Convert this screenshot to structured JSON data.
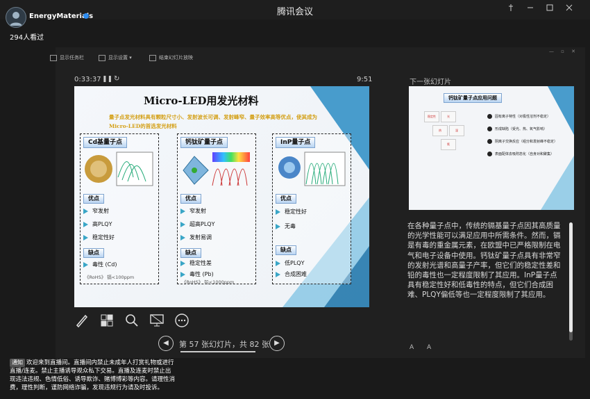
{
  "window": {
    "title": "腾讯会议"
  },
  "stream": {
    "streamer_name": "EnergyMaterials",
    "viewers": "294人看过"
  },
  "toolbar": {
    "show_taskbar": "显示任务栏",
    "display_settings": "显示设置 ▾",
    "end_slideshow": "结束幻灯片放映"
  },
  "presenter": {
    "elapsed": "0:33:37",
    "pause_icon": "pause-icon",
    "reset_icon": "reset-icon",
    "clock": "9:51",
    "next_slide_label": "下一张幻灯片",
    "slide_counter": "第 57 张幻灯片，共 82 张",
    "font_buttons": "A  A"
  },
  "slide": {
    "title": "Micro-LED用发光材料",
    "subtitle": "量子点发光材料具有颗粒尺寸小、发射波长可调、发射峰窄、量子效率高等优点，使其成为Micro-LED的首选发光材料",
    "boxes": [
      {
        "heading": "Cd基量子点",
        "pros_label": "优点",
        "pros": [
          "窄发射",
          "高PLQY",
          "稳定性好"
        ],
        "cons_label": "缺点",
        "cons": [
          "毒性 (Cd)"
        ],
        "footnote": "《RoHS》 镉<100ppm"
      },
      {
        "heading": "钙钛矿量子点",
        "pros_label": "优点",
        "pros": [
          "窄发射",
          "超高PLQY",
          "发射易调"
        ],
        "cons_label": "缺点",
        "cons": [
          "稳定性差",
          "毒性 (Pb)"
        ],
        "footnote": "《RoHS》 铅<1000ppm"
      },
      {
        "heading": "InP量子点",
        "pros_label": "优点",
        "pros": [
          "稳定性好",
          "无毒"
        ],
        "cons_label": "缺点",
        "cons": [
          "低PLQY",
          "合成困难"
        ],
        "footnote": ""
      }
    ]
  },
  "next_slide": {
    "title": "钙钛矿量子点应用问题",
    "items": [
      "固有离子特性（对极性溶剂不稳定）",
      "形成缺陷（受光、热、氧气影响）",
      "阴离子交换反应（组分和发射峰不稳定）",
      "表面配体去吸附态化（自身对和聚集）"
    ],
    "hexes": [
      "稳定性",
      "光",
      "热",
      "湿",
      "氧"
    ]
  },
  "notes": "在各种量子点中，传统的镉基量子点因其高质量的光学性能可以满足应用中所需条件。然而，镉是有毒的重金属元素，在欧盟中已严格限制在电气和电子设备中使用。钙钛矿量子点具有非常窄的发射光谱和高量子产率，但它们的稳定性差和铅的毒性也一定程度限制了其应用。InP量子点具有稳定性好和低毒性的特点，但它们合成困难、PLQY偏低等也一定程度限制了其应用。",
  "chat": {
    "tag": "通知",
    "message": "欢迎来到直播间。直播间内禁止未成年人打赏礼物或进行直播/连麦。禁止主播诱导观众私下交易。直播及连麦时禁止出现违法违规、色情低俗、诱导欺诈、赌博博彩等内容。请理性消费，理性判断，谨防网络诈骗，发现违规行为请及时投诉。"
  },
  "colors": {
    "accent_gold": "#d4a017",
    "arrow_teal": "#3aa6c7"
  }
}
